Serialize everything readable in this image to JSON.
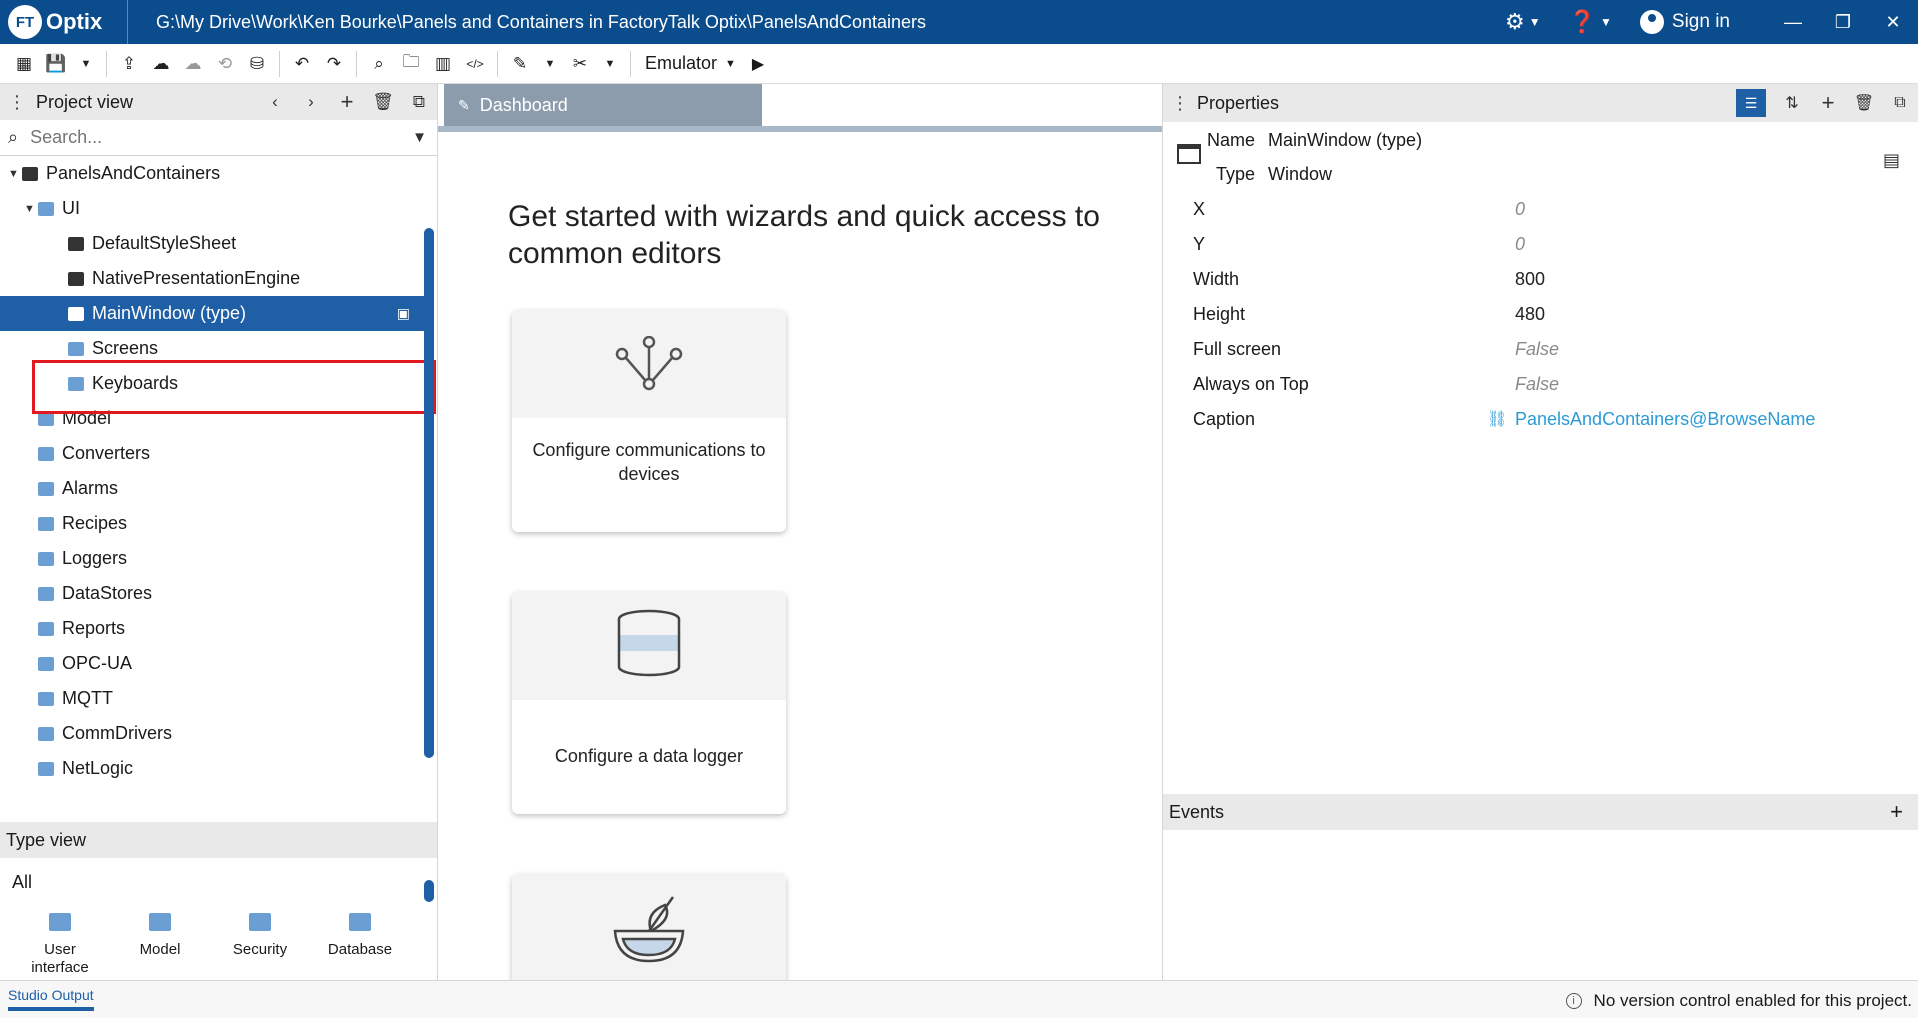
{
  "app": {
    "logo_badge": "FT",
    "logo_text": "Optix",
    "path": "G:\\My Drive\\Work\\Ken Bourke\\Panels and Containers in FactoryTalk Optix\\PanelsAndContainers",
    "sign_in": "Sign in",
    "brand_color": "#0b4c8c"
  },
  "toolbar": {
    "emulator_label": "Emulator"
  },
  "project_view": {
    "title": "Project view",
    "search_placeholder": "Search...",
    "tree": [
      {
        "label": "PanelsAndContainers",
        "level": 0,
        "expanded": true,
        "icon": "project-icon"
      },
      {
        "label": "UI",
        "level": 1,
        "expanded": true,
        "icon": "folder-icon"
      },
      {
        "label": "DefaultStyleSheet",
        "level": 2,
        "icon": "stylesheet-icon"
      },
      {
        "label": "NativePresentationEngine",
        "level": 2,
        "icon": "gear-icon"
      },
      {
        "label": "MainWindow (type)",
        "level": 2,
        "icon": "window-icon",
        "selected": true
      },
      {
        "label": "Screens",
        "level": 2,
        "icon": "folder-icon"
      },
      {
        "label": "Keyboards",
        "level": 2,
        "icon": "folder-icon"
      },
      {
        "label": "Model",
        "level": 1,
        "icon": "folder-icon"
      },
      {
        "label": "Converters",
        "level": 1,
        "icon": "folder-icon"
      },
      {
        "label": "Alarms",
        "level": 1,
        "icon": "folder-icon"
      },
      {
        "label": "Recipes",
        "level": 1,
        "icon": "folder-icon"
      },
      {
        "label": "Loggers",
        "level": 1,
        "icon": "folder-icon"
      },
      {
        "label": "DataStores",
        "level": 1,
        "icon": "folder-icon"
      },
      {
        "label": "Reports",
        "level": 1,
        "icon": "folder-icon"
      },
      {
        "label": "OPC-UA",
        "level": 1,
        "icon": "folder-icon"
      },
      {
        "label": "MQTT",
        "level": 1,
        "icon": "folder-icon"
      },
      {
        "label": "CommDrivers",
        "level": 1,
        "icon": "folder-icon"
      },
      {
        "label": "NetLogic",
        "level": 1,
        "icon": "folder-icon"
      }
    ]
  },
  "type_view": {
    "title": "Type view",
    "filter": "All",
    "items": [
      {
        "label": "User interface",
        "icon": "ui-folder-icon"
      },
      {
        "label": "Model",
        "icon": "model-folder-icon"
      },
      {
        "label": "Security",
        "icon": "security-folder-icon"
      },
      {
        "label": "Database",
        "icon": "database-folder-icon"
      }
    ]
  },
  "dashboard": {
    "tab_label": "Dashboard",
    "headline": "Get started with wizards and quick access to common editors",
    "cards": [
      {
        "label": "Configure communications to devices",
        "icon": "communications-icon"
      },
      {
        "label": "Configure a data logger",
        "icon": "database-icon"
      },
      {
        "label": "",
        "icon": "recipe-whisk-icon"
      }
    ]
  },
  "properties": {
    "title": "Properties",
    "name_label": "Name",
    "name_value": "MainWindow (type)",
    "type_label": "Type",
    "type_value": "Window",
    "rows": [
      {
        "label": "X",
        "value": "0",
        "style": "default"
      },
      {
        "label": "Y",
        "value": "0",
        "style": "default"
      },
      {
        "label": "Width",
        "value": "800",
        "style": "set"
      },
      {
        "label": "Height",
        "value": "480",
        "style": "set"
      },
      {
        "label": "Full screen",
        "value": "False",
        "style": "default"
      },
      {
        "label": "Always on Top",
        "value": "False",
        "style": "default"
      },
      {
        "label": "Caption",
        "value": "PanelsAndContainers@BrowseName",
        "style": "link"
      }
    ],
    "link_color": "#2b9bd6"
  },
  "events": {
    "title": "Events"
  },
  "status": {
    "output_tab": "Studio Output",
    "message": "No version control enabled for this project."
  }
}
